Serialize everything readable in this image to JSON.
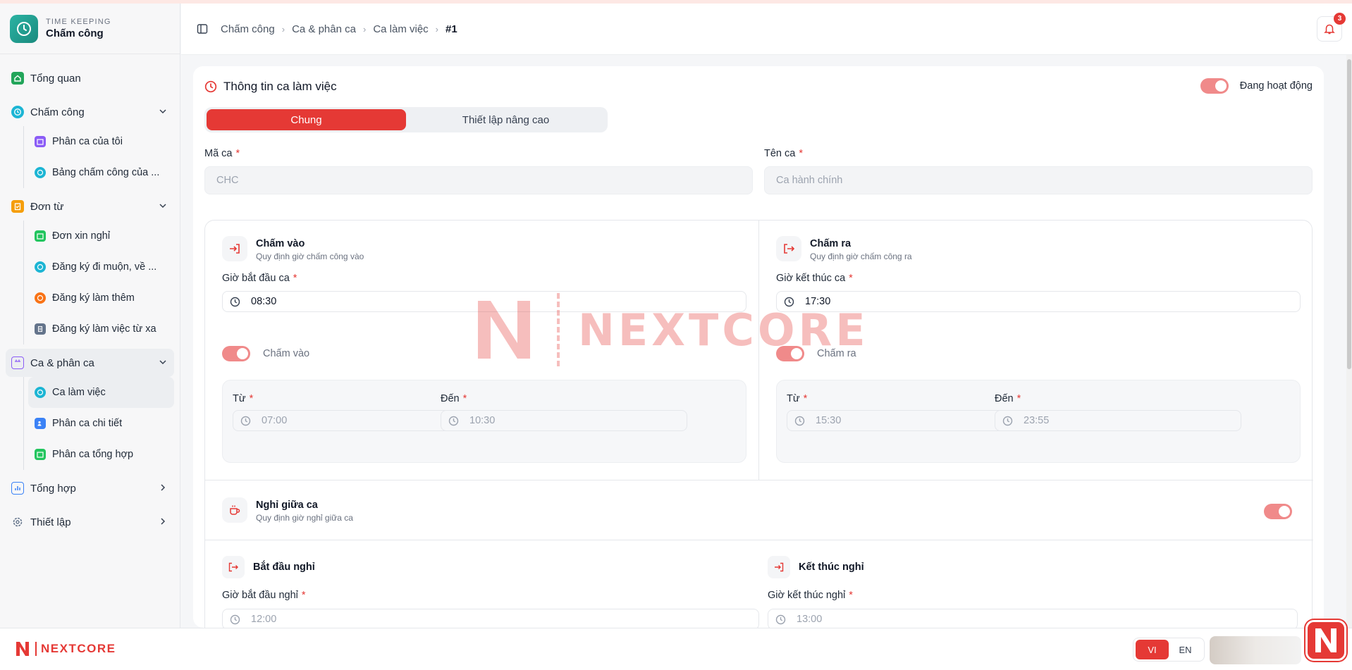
{
  "app": {
    "brand_sub": "TIME KEEPING",
    "brand_title": "Chấm công"
  },
  "sidebar": {
    "items": [
      {
        "label": "Tổng quan"
      },
      {
        "label": "Chấm công",
        "children": [
          "Phân ca của tôi",
          "Bảng chấm công của ..."
        ]
      },
      {
        "label": "Đơn từ",
        "children": [
          "Đơn xin nghỉ",
          "Đăng ký đi muộn, về ...",
          "Đăng ký làm thêm",
          "Đăng ký làm việc từ xa"
        ]
      },
      {
        "label": "Ca & phân ca",
        "children": [
          "Ca làm việc",
          "Phân ca chi tiết",
          "Phân ca tổng hợp"
        ]
      },
      {
        "label": "Tổng hợp"
      },
      {
        "label": "Thiết lập"
      }
    ]
  },
  "breadcrumb": [
    "Chấm công",
    "Ca & phân ca",
    "Ca làm việc",
    "#1"
  ],
  "notifications": {
    "count": "3"
  },
  "card": {
    "title": "Thông tin ca làm việc",
    "status_label": "Đang hoạt động",
    "tabs": [
      "Chung",
      "Thiết lập nâng cao"
    ],
    "code_label": "Mã ca",
    "code_value": "CHC",
    "name_label": "Tên ca",
    "name_value": "Ca hành chính"
  },
  "checkin": {
    "title": "Chấm vào",
    "subtitle": "Quy định giờ chấm công vào",
    "time_label": "Giờ bắt đầu ca",
    "time_value": "08:30",
    "toggle_label": "Chấm vào",
    "from_label": "Từ",
    "from_value": "07:00",
    "to_label": "Đến",
    "to_value": "10:30"
  },
  "checkout": {
    "title": "Chấm ra",
    "subtitle": "Quy định giờ chấm công ra",
    "time_label": "Giờ kết thúc ca",
    "time_value": "17:30",
    "toggle_label": "Chấm ra",
    "from_label": "Từ",
    "from_value": "15:30",
    "to_label": "Đến",
    "to_value": "23:55"
  },
  "break": {
    "title": "Nghỉ giữa ca",
    "subtitle": "Quy định giờ nghỉ giữa ca",
    "start_title": "Bắt đầu nghỉ",
    "start_label": "Giờ bắt đầu nghỉ",
    "start_value": "12:00",
    "end_title": "Kết thúc nghỉ",
    "end_label": "Giờ kết thúc nghỉ",
    "end_value": "13:00"
  },
  "watermark": "NEXTCORE",
  "footer": {
    "brand": "NEXTCORE",
    "lang": [
      "VI",
      "EN"
    ]
  },
  "colors": {
    "accent": "#e53935",
    "toggle": "#f08a8a"
  }
}
